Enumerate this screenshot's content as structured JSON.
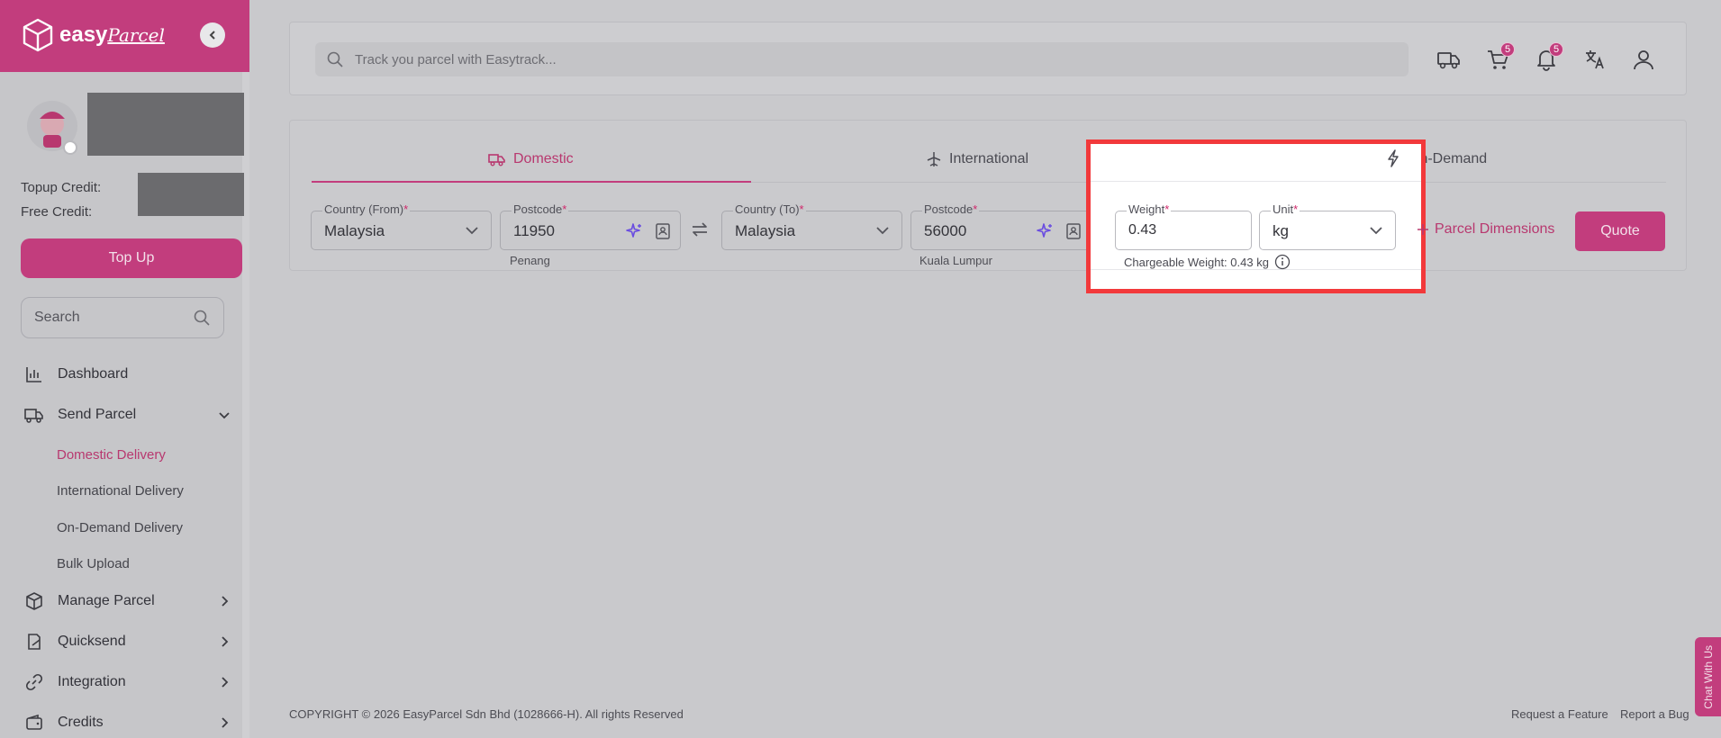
{
  "brand": {
    "name_bold": "easy",
    "name_script": "Parcel"
  },
  "sidebar": {
    "topup_credit_label": "Topup Credit:",
    "free_credit_label": "Free Credit:",
    "topup_button": "Top Up",
    "search_placeholder": "Search",
    "nav": [
      {
        "label": "Dashboard",
        "icon": "chart-icon"
      },
      {
        "label": "Send Parcel",
        "icon": "truck-icon",
        "expanded": true
      },
      {
        "label": "Manage Parcel",
        "icon": "box-icon"
      },
      {
        "label": "Quicksend",
        "icon": "edit-icon"
      },
      {
        "label": "Integration",
        "icon": "link-icon"
      },
      {
        "label": "Credits",
        "icon": "wallet-icon"
      }
    ],
    "send_parcel_sub": [
      "Domestic Delivery",
      "International Delivery",
      "On-Demand Delivery",
      "Bulk Upload"
    ]
  },
  "topbar": {
    "track_placeholder": "Track you parcel with Easytrack...",
    "cart_badge": "5",
    "notification_badge": "5"
  },
  "quote": {
    "tabs": [
      "Domestic",
      "International",
      "On-Demand"
    ],
    "country_from": {
      "label": "Country (From)",
      "value": "Malaysia"
    },
    "postcode_from": {
      "label": "Postcode",
      "value": "11950",
      "city": "Penang"
    },
    "country_to": {
      "label": "Country (To)",
      "value": "Malaysia"
    },
    "postcode_to": {
      "label": "Postcode",
      "value": "56000",
      "city": "Kuala Lumpur"
    },
    "weight": {
      "label": "Weight",
      "value": "0.43"
    },
    "unit": {
      "label": "Unit",
      "value": "kg"
    },
    "chargeable_weight": "Chargeable Weight: 0.43 kg",
    "parcel_dimensions": "Parcel Dimensions",
    "quote_button": "Quote",
    "required_mark": "*"
  },
  "footer": {
    "copyright": "COPYRIGHT © 2026 EasyParcel Sdn Bhd (1028666-H). All rights Reserved",
    "request_feature": "Request a Feature",
    "report_bug": "Report a Bug",
    "chat": "Chat With Us"
  },
  "colors": {
    "brand": "#c23d7d",
    "highlight_border": "#f2393b",
    "sparkle": "#6a4de0"
  }
}
